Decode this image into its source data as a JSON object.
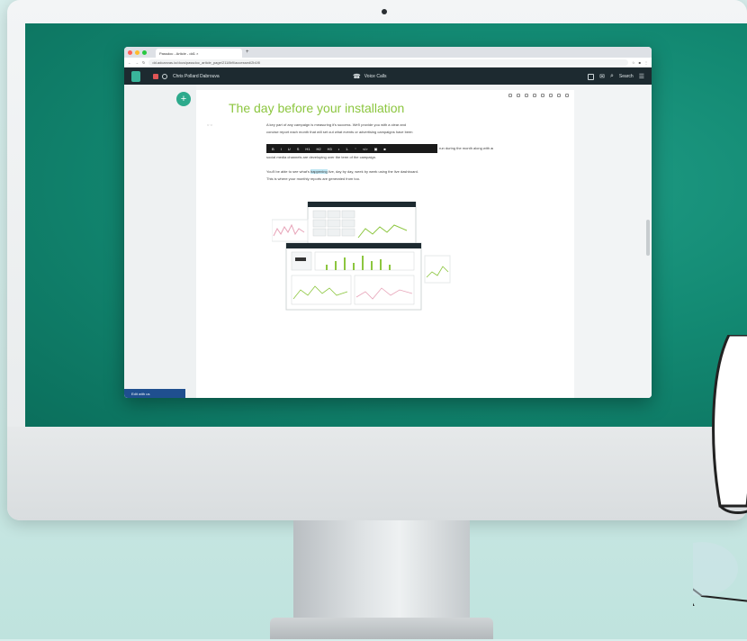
{
  "browser": {
    "tab_title": "Passdoc - Article - dd1 ×",
    "url": "dd.adcanvas.io/docs/passdoc_article_page/2118b9/accessed/2b1f0",
    "window_dots": [
      "#ff5f57",
      "#febc2e",
      "#28c840"
    ]
  },
  "app": {
    "workspace_name": "Chris Pollard Dabrouva",
    "phone_label": "Voice Calls",
    "search_label": "Search"
  },
  "document": {
    "title": "The day before your installation",
    "gutter_marks": "○  ○",
    "para1_line1": "A key part of any campaign is measuring it's success. We'll provide you with a clear and",
    "para1_line2": "concise report each month that will set out what events or advertising campaigns have been",
    "para1_line3": "run during the month along with an analysis of the data available for reporting on how your",
    "para1_line4": "social media channels are developing over the term of the campaign.",
    "para2_before": "You'll be able to see what's",
    "para2_highlight": "happening",
    "para2_after": "live, day by day, week by week using the live dashboard.",
    "para2_line2": "This is where your monthly reports are generated from too.",
    "toolbar_items": [
      "B",
      "I",
      "U",
      "S",
      "H1",
      "H2",
      "H3",
      "•",
      "1.",
      "“",
      "</>",
      "▣",
      "■"
    ],
    "mode_badge": "Edit with us"
  },
  "colors": {
    "title_green": "#8cc63f",
    "accent_teal": "#2daa8c",
    "appbar_dark": "#1d2a30",
    "badge_blue": "#1f4f8f"
  },
  "icons": {
    "add": "+",
    "phone": "☎",
    "search": "⌕",
    "menu": "☰",
    "chat": "✉"
  }
}
